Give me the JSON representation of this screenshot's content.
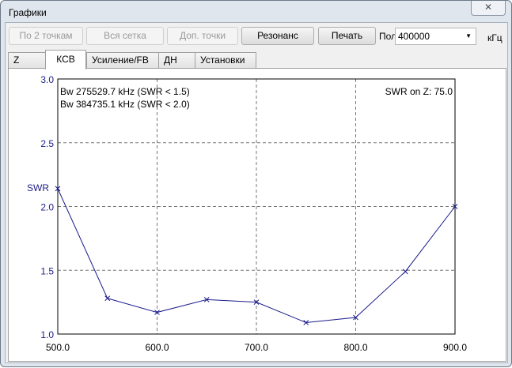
{
  "window": {
    "title": "Графики",
    "close_icon": "close-icon"
  },
  "toolbar": {
    "btn_2pts": "По 2 точкам",
    "btn_grid": "Вся сетка",
    "btn_extra": "Доп. точки",
    "btn_resonance": "Резонанс",
    "btn_print": "Печать",
    "band_label": "Полоса",
    "band_value": "400000",
    "band_unit": "кГц"
  },
  "tabs": [
    "Z",
    "КСВ",
    "Усиление/FB",
    "ДН",
    "Установки"
  ],
  "chart_data": {
    "type": "line",
    "x": [
      500,
      550,
      600,
      650,
      700,
      750,
      800,
      850,
      900
    ],
    "series": [
      {
        "name": "SWR",
        "values": [
          2.14,
          1.28,
          1.17,
          1.27,
          1.25,
          1.09,
          1.13,
          1.49,
          2.0
        ],
        "color": "#1a1a8c"
      }
    ],
    "xlim": [
      500,
      900
    ],
    "ylim": [
      1.0,
      3.0
    ],
    "xticks": [
      "500.0",
      "600.0",
      "700.0",
      "800.0",
      "900.0"
    ],
    "yticks": [
      "1.0",
      "1.5",
      "2.0",
      "2.5",
      "3.0"
    ],
    "ylabel": "SWR",
    "annotations": {
      "bw15": "Bw 275529.7 kHz (SWR < 1.5)",
      "bw20": "Bw 384735.1 kHz (SWR < 2.0)",
      "z": "SWR on Z: 75.0"
    },
    "grid": true
  }
}
